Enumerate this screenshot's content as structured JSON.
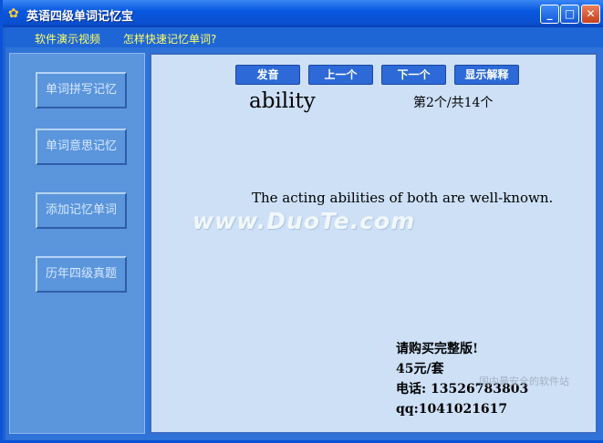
{
  "window": {
    "title": "英语四级单词记忆宝",
    "icon": "app-icon",
    "controls": {
      "minimize": "_",
      "maximize": "□",
      "close": "✕"
    }
  },
  "menu": {
    "items": [
      {
        "label": "软件演示视频"
      },
      {
        "label": "怎样快速记忆单词?"
      }
    ]
  },
  "sidebar": {
    "buttons": [
      {
        "label": "单词拼写记忆"
      },
      {
        "label": "单词意思记忆"
      },
      {
        "label": "添加记忆单词"
      },
      {
        "label": "历年四级真题"
      }
    ]
  },
  "toolbar": {
    "pronounce": "发音",
    "prev": "上一个",
    "next": "下一个",
    "show_meaning": "显示解释"
  },
  "card": {
    "word": "ability",
    "counter": "第2个/共14个",
    "example": "The acting abilities of both are well-known."
  },
  "watermark": "www.DuoTe.com",
  "promo": {
    "line1": "请购买完整版!",
    "line2": "45元/套",
    "line3": "电话: 13526783803",
    "line4": "qq:1041021617"
  },
  "corner_watermark": "国内最安全的软件站"
}
